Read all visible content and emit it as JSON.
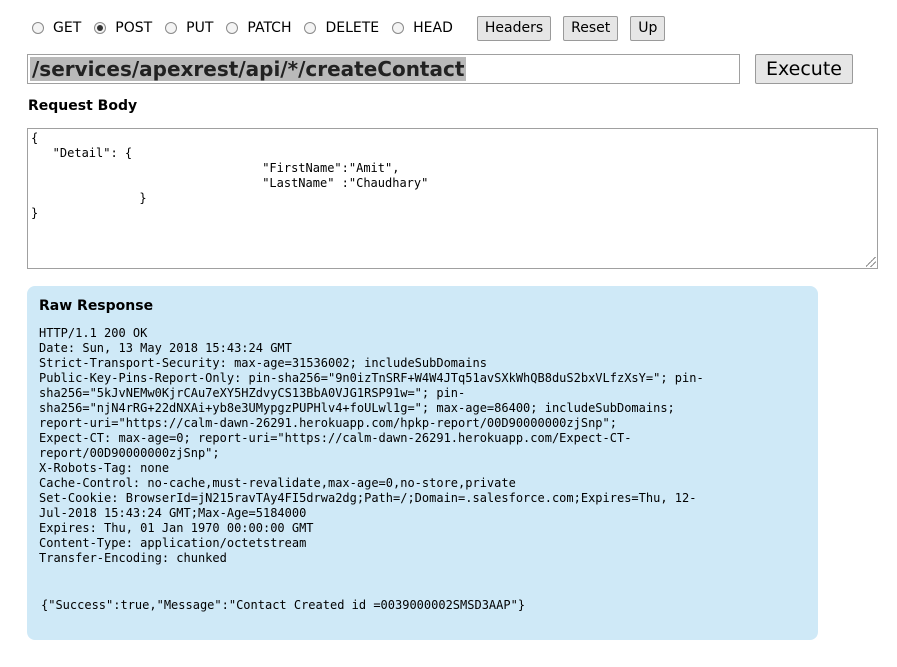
{
  "methods": [
    {
      "label": "GET",
      "checked": false
    },
    {
      "label": "POST",
      "checked": true
    },
    {
      "label": "PUT",
      "checked": false
    },
    {
      "label": "PATCH",
      "checked": false
    },
    {
      "label": "DELETE",
      "checked": false
    },
    {
      "label": "HEAD",
      "checked": false
    }
  ],
  "buttons": {
    "headers": "Headers",
    "reset": "Reset",
    "up": "Up",
    "execute": "Execute"
  },
  "url": "/services/apexrest/api/*/createContact",
  "request_body": {
    "title": "Request Body",
    "text": "{\n   \"Detail\": {\n                                \"FirstName\":\"Amit\",\n                                \"LastName\" :\"Chaudhary\"\n               }\n}"
  },
  "response": {
    "title": "Raw Response",
    "headers": "HTTP/1.1 200 OK\nDate: Sun, 13 May 2018 15:43:24 GMT\nStrict-Transport-Security: max-age=31536002; includeSubDomains\nPublic-Key-Pins-Report-Only: pin-sha256=\"9n0izTnSRF+W4W4JTq51avSXkWhQB8duS2bxVLfzXsY=\"; pin-\nsha256=\"5kJvNEMw0KjrCAu7eXY5HZdvyCS13BbA0VJG1RSP91w=\"; pin-\nsha256=\"njN4rRG+22dNXAi+yb8e3UMypgzPUPHlv4+foULwl1g=\"; max-age=86400; includeSubDomains;\nreport-uri=\"https://calm-dawn-26291.herokuapp.com/hpkp-report/00D90000000zjSnp\";\nExpect-CT: max-age=0; report-uri=\"https://calm-dawn-26291.herokuapp.com/Expect-CT-\nreport/00D90000000zjSnp\";\nX-Robots-Tag: none\nCache-Control: no-cache,must-revalidate,max-age=0,no-store,private\nSet-Cookie: BrowserId=jN215ravTAy4FI5drwa2dg;Path=/;Domain=.salesforce.com;Expires=Thu, 12-\nJul-2018 15:43:24 GMT;Max-Age=5184000\nExpires: Thu, 01 Jan 1970 00:00:00 GMT\nContent-Type: application/octetstream\nTransfer-Encoding: chunked",
    "body": "{\"Success\":true,\"Message\":\"Contact Created id =0039000002SMSD3AAP\"}"
  }
}
